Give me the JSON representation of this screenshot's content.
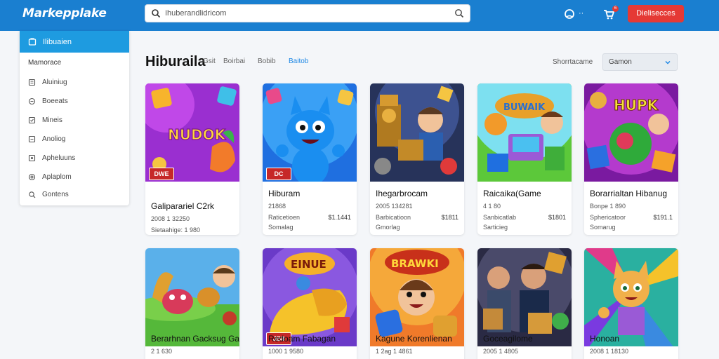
{
  "header": {
    "logo": "Markepplake",
    "search_placeholder": "Ihuberandlidricom",
    "user_label": "··",
    "cart_count": "6",
    "button": "Dielisecces"
  },
  "sidebar": {
    "active": "Ilibuaien",
    "section": "Mamorace",
    "items": [
      "Aluiniug",
      "Boeeats",
      "Mineis",
      "Anoliog",
      "Apheluuns",
      "Aplaplom",
      "Gontens"
    ]
  },
  "main": {
    "title": "Hiburaila",
    "tabs": [
      "Gsit",
      "Boirbai",
      "Bobib",
      "Baitob"
    ],
    "active_tab": 3,
    "sort_label": "Shorrtacame",
    "sort_value": "Gamon"
  },
  "cards": [
    {
      "title": "Galiparariel C2rk",
      "line1": "2008 1 32250",
      "line2": "Sietaahige: 1 980",
      "price": "",
      "line3": "",
      "badge": "DWE"
    },
    {
      "title": "Hiburam",
      "line1": "21868",
      "line2": "Raticetioen",
      "price": "$1.1441",
      "line3": "Somalag",
      "badge": "DC"
    },
    {
      "title": "Ihegarbrocam",
      "line1": "2005 134281",
      "line2": "Barbicatioon",
      "price": "$1811",
      "line3": "Gmorlag",
      "badge": ""
    },
    {
      "title": "Raicaika(Game",
      "line1": "4 1 80",
      "line2": "Sanbicatlab",
      "price": "$1801",
      "line3": "Sarticieg",
      "badge": ""
    },
    {
      "title": "Borarrialtan Hibanug",
      "line1": "Bonpe 1 890",
      "line2": "Sphericatoor",
      "price": "$191.1",
      "line3": "Somarug",
      "badge": ""
    },
    {
      "title": "Berarhnan Gacksug Game",
      "line1": "2 1 630",
      "line2": "",
      "price": "",
      "line3": "",
      "badge": ""
    },
    {
      "title": "Redoam Fabagan",
      "line1": "1000 1 9580",
      "line2": "",
      "price": "",
      "line3": "",
      "badge": "JB8"
    },
    {
      "title": "Kagune Korenlienan",
      "line1": "1 2ag 1 4861",
      "line2": "",
      "price": "",
      "line3": "",
      "badge": ""
    },
    {
      "title": "Goceagilome",
      "line1": "2005 1 4805",
      "line2": "",
      "price": "",
      "line3": "",
      "badge": ""
    },
    {
      "title": "Honoan",
      "line1": "2008 1 18130",
      "line2": "",
      "price": "",
      "line3": "",
      "badge": ""
    }
  ],
  "art_texts": [
    "NUDOK",
    "HUPK",
    "BUWAIK",
    "EINUE",
    "BRAWKI"
  ],
  "colors": {
    "header": "#1a7fd0",
    "accent": "#1e9be0",
    "button": "#e53935"
  }
}
